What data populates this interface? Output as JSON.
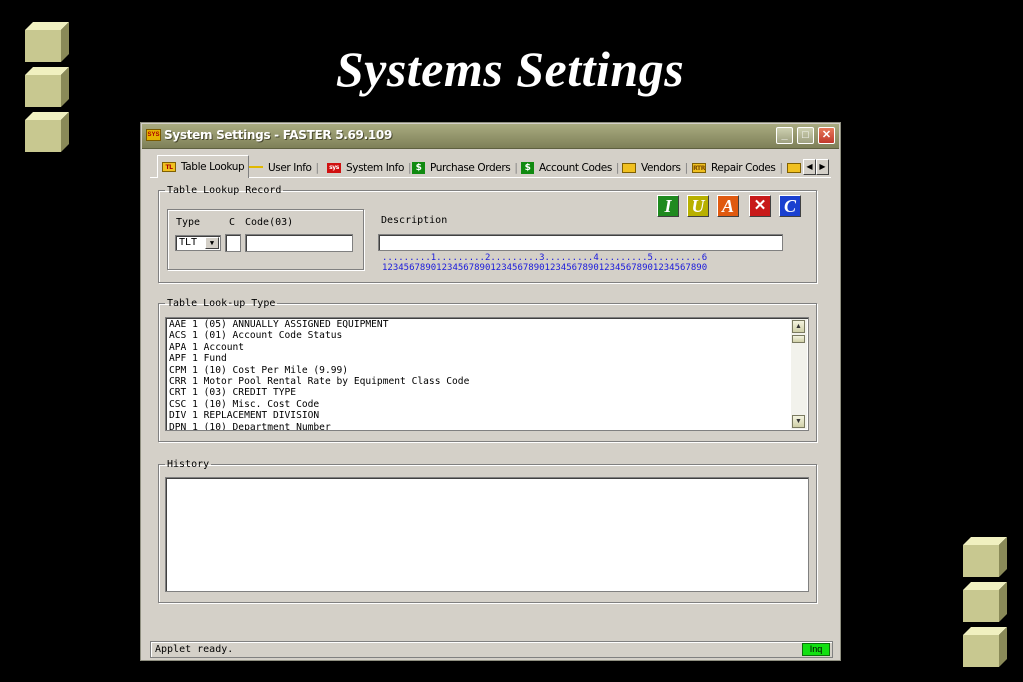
{
  "slide": {
    "title": "Systems Settings"
  },
  "window": {
    "title": "System Settings - FASTER 5.69.109",
    "controls": {
      "minimize": "_",
      "maximize": "□",
      "close": "✕"
    }
  },
  "tabs": [
    {
      "label": "Table Lookup",
      "icon": "table-icon"
    },
    {
      "label": "User Info",
      "icon": "key-icon"
    },
    {
      "label": "System Info",
      "icon": "system-icon"
    },
    {
      "label": "Purchase Orders",
      "icon": "dollar-icon"
    },
    {
      "label": "Account Codes",
      "icon": "dollar-icon"
    },
    {
      "label": "Vendors",
      "icon": "building-icon"
    },
    {
      "label": "Repair Codes",
      "icon": "repair-icon"
    }
  ],
  "record": {
    "legend": "Table Lookup Record",
    "type_label": "Type",
    "c_label": "C",
    "code_label": "Code(03)",
    "type_value": "TLT",
    "description_label": "Description",
    "ruler_top": ".........1.........2.........3.........4.........5.........6",
    "ruler_bottom": "123456789012345678901234567890123456789012345678901234567890",
    "actions": [
      {
        "label": "I",
        "color": "#1f8a1f"
      },
      {
        "label": "U",
        "color": "#b8b000"
      },
      {
        "label": "A",
        "color": "#e05a10"
      },
      {
        "label": "✕",
        "color": "#c81a1a"
      },
      {
        "label": "C",
        "color": "#1a40d0"
      }
    ]
  },
  "lookup": {
    "legend": "Table Look-up Type",
    "items": [
      "AAE 1 (05) ANNUALLY ASSIGNED EQUIPMENT",
      "ACS 1 (01) Account Code Status",
      "APA 1 Account",
      "APF 1 Fund",
      "CPM 1 (10) Cost Per Mile (9.99)",
      "CRR 1 Motor Pool Rental Rate by Equipment Class Code",
      "CRT 1 (03) CREDIT TYPE",
      "CSC 1 (10) Misc. Cost Code",
      "DIV 1 REPLACEMENT DIVISION",
      "DPN 1 (10) Department Number"
    ]
  },
  "history": {
    "legend": "History"
  },
  "status": {
    "text": "Applet ready.",
    "badge": "Inq",
    "badge_color": "#12e012"
  }
}
